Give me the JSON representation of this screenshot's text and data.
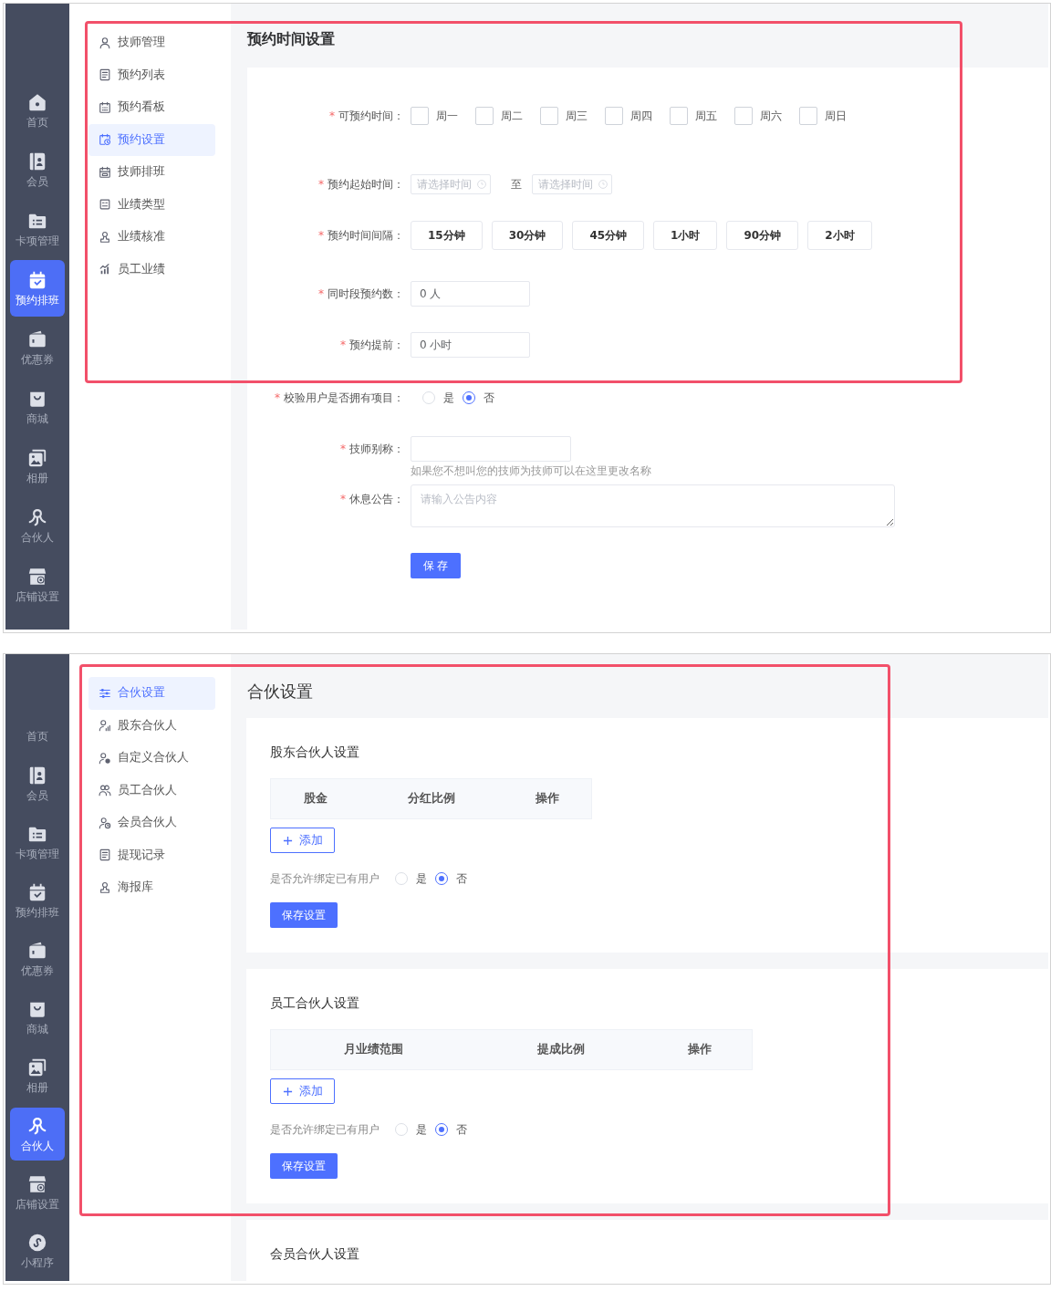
{
  "screens": [
    {
      "kind": "appointment_settings",
      "nav": [
        {
          "label": "首页",
          "selected": false,
          "icon_hidden": false
        },
        {
          "label": "会员",
          "selected": false,
          "icon_hidden": false
        },
        {
          "label": "卡项管理",
          "selected": false,
          "icon_hidden": false
        },
        {
          "label": "预约排班",
          "selected": true,
          "icon_hidden": false
        },
        {
          "label": "优惠券",
          "selected": false,
          "icon_hidden": false
        },
        {
          "label": "商城",
          "selected": false,
          "icon_hidden": false
        },
        {
          "label": "相册",
          "selected": false,
          "icon_hidden": false
        },
        {
          "label": "合伙人",
          "selected": false,
          "icon_hidden": false
        },
        {
          "label": "店铺设置",
          "selected": false,
          "icon_hidden": false
        }
      ],
      "submenu": [
        {
          "label": "技师管理",
          "selected": false
        },
        {
          "label": "预约列表",
          "selected": false
        },
        {
          "label": "预约看板",
          "selected": false
        },
        {
          "label": "预约设置",
          "selected": true
        },
        {
          "label": "技师排班",
          "selected": false
        },
        {
          "label": "业绩类型",
          "selected": false
        },
        {
          "label": "业绩核准",
          "selected": false
        },
        {
          "label": "员工业绩",
          "selected": false
        }
      ],
      "page_title": "预约时间设置",
      "form": {
        "fields": [
          {
            "kind": "checkboxes",
            "required_mark": "*",
            "label": "可预约时间：",
            "options": [
              {
                "label": "周一",
                "checked": false
              },
              {
                "label": "周二",
                "checked": false
              },
              {
                "label": "周三",
                "checked": false
              },
              {
                "label": "周四",
                "checked": false
              },
              {
                "label": "周五",
                "checked": false
              },
              {
                "label": "周六",
                "checked": false
              },
              {
                "label": "周日",
                "checked": false
              }
            ]
          },
          {
            "kind": "time_range",
            "required_mark": "*",
            "label": "预约起始时间：",
            "start": {
              "placeholder": "请选择时间"
            },
            "separator": "至",
            "end": {
              "placeholder": "请选择时间"
            }
          },
          {
            "kind": "option_buttons",
            "required_mark": "*",
            "label": "预约时间间隔：",
            "options": [
              {
                "label": "15分钟",
                "selected": false
              },
              {
                "label": "30分钟",
                "selected": false
              },
              {
                "label": "45分钟",
                "selected": false
              },
              {
                "label": "1小时",
                "selected": false
              },
              {
                "label": "90分钟",
                "selected": false
              },
              {
                "label": "2小时",
                "selected": false
              }
            ]
          },
          {
            "kind": "input",
            "required_mark": "*",
            "label": "同时段预约数：",
            "value": "0 人"
          },
          {
            "kind": "input",
            "required_mark": "*",
            "label": "预约提前：",
            "value": "0 小时"
          },
          {
            "kind": "radio",
            "required_mark": "*",
            "label": "校验用户是否拥有项目：",
            "options": [
              {
                "label": "是",
                "selected": false
              },
              {
                "label": "否",
                "selected": true
              }
            ]
          },
          {
            "kind": "input",
            "required_mark": "*",
            "label": "技师别称：",
            "hint": "如果您不想叫您的技师为技师可以在这里更改名称"
          },
          {
            "kind": "textarea",
            "required_mark": "*",
            "label": "休息公告：",
            "placeholder": "请输入公告内容"
          }
        ],
        "save_button": "保 存"
      }
    },
    {
      "kind": "partner_settings",
      "nav": [
        {
          "label": "首页",
          "selected": false,
          "icon_hidden": true
        },
        {
          "label": "会员",
          "selected": false,
          "icon_hidden": false
        },
        {
          "label": "卡项管理",
          "selected": false,
          "icon_hidden": false
        },
        {
          "label": "预约排班",
          "selected": false,
          "icon_hidden": false
        },
        {
          "label": "优惠券",
          "selected": false,
          "icon_hidden": false
        },
        {
          "label": "商城",
          "selected": false,
          "icon_hidden": false
        },
        {
          "label": "相册",
          "selected": false,
          "icon_hidden": false
        },
        {
          "label": "合伙人",
          "selected": true,
          "icon_hidden": false
        },
        {
          "label": "店铺设置",
          "selected": false,
          "icon_hidden": false
        },
        {
          "label": "小程序",
          "selected": false,
          "icon_hidden": false
        }
      ],
      "submenu": [
        {
          "label": "合伙设置",
          "selected": true
        },
        {
          "label": "股东合伙人",
          "selected": false
        },
        {
          "label": "自定义合伙人",
          "selected": false
        },
        {
          "label": "员工合伙人",
          "selected": false
        },
        {
          "label": "会员合伙人",
          "selected": false
        },
        {
          "label": "提现记录",
          "selected": false
        },
        {
          "label": "海报库",
          "selected": false
        }
      ],
      "page_title": "合伙设置",
      "sections": [
        {
          "title": "股东合伙人设置",
          "table": {
            "columns": [
              "股金",
              "分红比例",
              "操作"
            ]
          },
          "add_button": "添加",
          "binding": {
            "label": "是否允许绑定已有用户",
            "options": [
              {
                "label": "是",
                "selected": false
              },
              {
                "label": "否",
                "selected": true
              }
            ]
          },
          "save_button": "保存设置"
        },
        {
          "title": "员工合伙人设置",
          "table": {
            "columns": [
              "月业绩范围",
              "提成比例",
              "操作"
            ]
          },
          "add_button": "添加",
          "binding": {
            "label": "是否允许绑定已有用户",
            "options": [
              {
                "label": "是",
                "selected": false
              },
              {
                "label": "否",
                "selected": true
              }
            ]
          },
          "save_button": "保存设置"
        },
        {
          "title": "会员合伙人设置"
        }
      ]
    }
  ]
}
